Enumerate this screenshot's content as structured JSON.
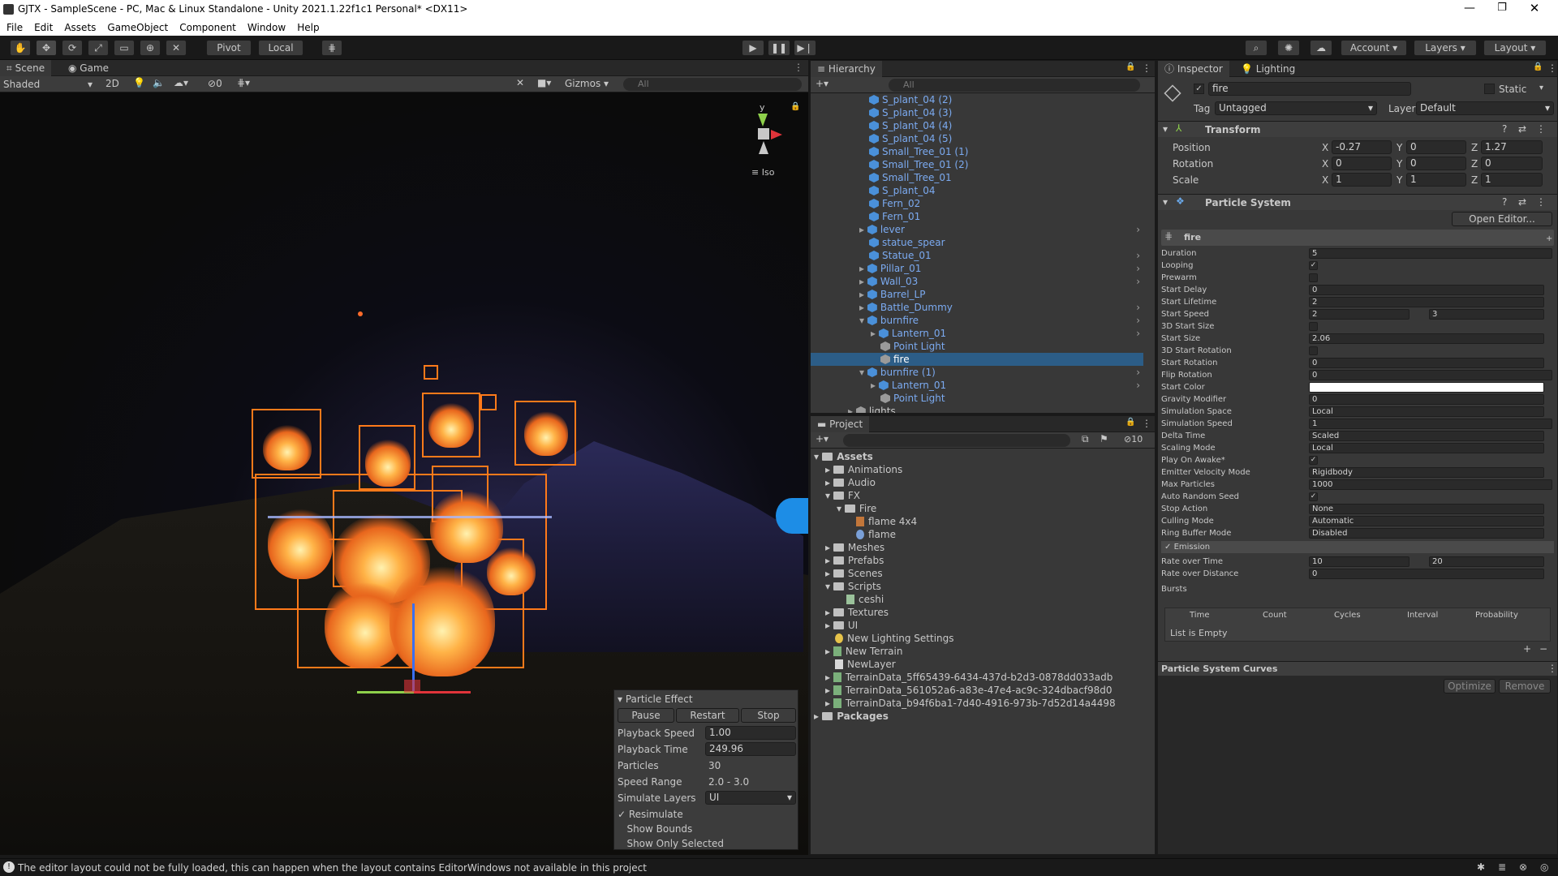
{
  "window": {
    "title": "GJTX - SampleScene - PC, Mac & Linux Standalone - Unity 2021.1.22f1c1 Personal* <DX11>"
  },
  "menu": [
    "File",
    "Edit",
    "Assets",
    "GameObject",
    "Component",
    "Window",
    "Help"
  ],
  "toolbar": {
    "pivot": "Pivot",
    "local": "Local",
    "account": "Account",
    "layers": "Layers",
    "layout": "Layout"
  },
  "scene": {
    "tab_scene": "Scene",
    "tab_game": "Game",
    "shading": "Shaded",
    "mode_2d": "2D",
    "gizmos": "Gizmos",
    "search_placeholder": "All",
    "iso": "Iso",
    "axis_y": "y",
    "hidden_count": "0"
  },
  "particle_effect": {
    "title": "Particle Effect",
    "pause": "Pause",
    "restart": "Restart",
    "stop": "Stop",
    "rows": [
      {
        "label": "Playback Speed",
        "value": "1.00"
      },
      {
        "label": "Playback Time",
        "value": "249.96"
      },
      {
        "label": "Particles",
        "value": "30"
      },
      {
        "label": "Speed Range",
        "value": "2.0 - 3.0"
      },
      {
        "label": "Simulate Layers",
        "value": "UI"
      }
    ],
    "resimulate": "Resimulate",
    "show_bounds": "Show Bounds",
    "show_only_selected": "Show Only Selected"
  },
  "hierarchy": {
    "title": "Hierarchy",
    "search_placeholder": "All",
    "items": [
      "S_plant_04 (2)",
      "S_plant_04 (3)",
      "S_plant_04 (4)",
      "S_plant_04 (5)",
      "Small_Tree_01 (1)",
      "Small_Tree_01 (2)",
      "Small_Tree_01",
      "S_plant_04",
      "Fern_02",
      "Fern_01",
      "lever",
      "statue_spear",
      "Statue_01",
      "Pillar_01",
      "Wall_03",
      "Barrel_LP",
      "Battle_Dummy",
      "burnfire",
      "Lantern_01",
      "Point Light",
      "fire",
      "burnfire (1)",
      "Lantern_01",
      "Point Light",
      "lights"
    ]
  },
  "project": {
    "title": "Project",
    "hidden_count": "10",
    "items": [
      "Assets",
      "Animations",
      "Audio",
      "FX",
      "Fire",
      "flame 4x4",
      "flame",
      "Meshes",
      "Prefabs",
      "Scenes",
      "Scripts",
      "ceshi",
      "Textures",
      "UI",
      "New Lighting Settings",
      "New Terrain",
      "NewLayer",
      "TerrainData_5ff65439-6434-437d-b2d3-0878dd033adb",
      "TerrainData_561052a6-a83e-47e4-ac9c-324dbacf98d0",
      "TerrainData_b94f6ba1-7d40-4916-973b-7d52d14a4498",
      "Packages"
    ]
  },
  "inspector": {
    "tab_inspector": "Inspector",
    "tab_lighting": "Lighting",
    "object_name": "fire",
    "static": "Static",
    "tag_label": "Tag",
    "tag": "Untagged",
    "layer_label": "Layer",
    "layer": "Default",
    "transform": {
      "title": "Transform",
      "position": {
        "label": "Position",
        "x": "-0.27",
        "y": "0",
        "z": "1.27"
      },
      "rotation": {
        "label": "Rotation",
        "x": "0",
        "y": "0",
        "z": "0"
      },
      "scale": {
        "label": "Scale",
        "x": "1",
        "y": "1",
        "z": "1"
      }
    },
    "particle_system": {
      "title": "Particle System",
      "open_editor": "Open Editor...",
      "module": "fire",
      "props": [
        {
          "label": "Duration",
          "value": "5"
        },
        {
          "label": "Looping",
          "check": "✓"
        },
        {
          "label": "Prewarm",
          "check": ""
        },
        {
          "label": "Start Delay",
          "value": "0"
        },
        {
          "label": "Start Lifetime",
          "value": "2"
        },
        {
          "label": "Start Speed",
          "value": "2",
          "value2": "3"
        },
        {
          "label": "3D Start Size",
          "check": ""
        },
        {
          "label": "Start Size",
          "value": "2.06"
        },
        {
          "label": "3D Start Rotation",
          "check": ""
        },
        {
          "label": "Start Rotation",
          "value": "0"
        },
        {
          "label": "Flip Rotation",
          "value": "0"
        },
        {
          "label": "Start Color",
          "value": ""
        },
        {
          "label": "Gravity Modifier",
          "value": "0"
        },
        {
          "label": "Simulation Space",
          "value": "Local"
        },
        {
          "label": "Simulation Speed",
          "value": "1"
        },
        {
          "label": "Delta Time",
          "value": "Scaled"
        },
        {
          "label": "Scaling Mode",
          "value": "Local"
        },
        {
          "label": "Play On Awake*",
          "check": "✓"
        },
        {
          "label": "Emitter Velocity Mode",
          "value": "Rigidbody"
        },
        {
          "label": "Max Particles",
          "value": "1000"
        },
        {
          "label": "Auto Random Seed",
          "check": "✓"
        },
        {
          "label": "Stop Action",
          "value": "None"
        },
        {
          "label": "Culling Mode",
          "value": "Automatic"
        },
        {
          "label": "Ring Buffer Mode",
          "value": "Disabled"
        }
      ],
      "emission": "Emission",
      "rate_over_time": {
        "label": "Rate over Time",
        "value": "10",
        "value2": "20"
      },
      "rate_over_distance": {
        "label": "Rate over Distance",
        "value": "0"
      },
      "bursts": "Bursts",
      "burst_cols": [
        "Time",
        "Count",
        "Cycles",
        "Interval",
        "Probability"
      ],
      "list_empty": "List is Empty"
    },
    "curves": {
      "title": "Particle System Curves",
      "optimize": "Optimize",
      "remove": "Remove"
    }
  },
  "status": {
    "message": "The editor layout could not be fully loaded, this can happen when the layout contains EditorWindows not available in this project"
  }
}
